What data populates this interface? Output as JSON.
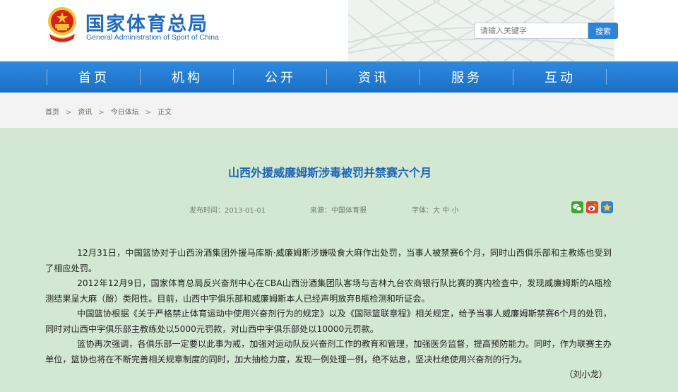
{
  "header": {
    "site_name": "国家体育总局",
    "site_name_en": "General Administration of Sport of China",
    "search_placeholder": "请输入关键字",
    "search_button": "搜索"
  },
  "nav": {
    "items": [
      "首页",
      "机构",
      "公开",
      "资讯",
      "服务",
      "互动"
    ]
  },
  "breadcrumb": {
    "items": [
      "首页",
      "资讯",
      "今日体坛",
      "正文"
    ],
    "separator": ">"
  },
  "article": {
    "title": "山西外援威廉姆斯涉毒被罚并禁赛六个月",
    "published": "发布时间：2013-01-01",
    "source": "来源：中国体育报",
    "font_label": "字体：",
    "font_large": "大",
    "font_medium": "中",
    "font_small": "小",
    "paragraphs": [
      "12月31日，中国篮协对于山西汾酒集团外援马库斯·威廉姆斯涉嫌吸食大麻作出处罚，当事人被禁赛6个月，同时山西俱乐部和主教练也受到了相应处罚。",
      "2012年12月9日，国家体育总局反兴奋剂中心在CBA山西汾酒集团队客场与吉林九台农商银行队比赛的赛内检查中，发现威廉姆斯的A瓶检测结果呈大麻（酚）类阳性。目前，山西中宇俱乐部和威廉姆斯本人已经声明放弃B瓶检测和听证会。",
      "中国篮协根据《关于严格禁止体育运动中使用兴奋剂行为的规定》以及《国际篮联章程》相关规定，给予当事人威廉姆斯禁赛6个月的处罚，同时对山西中宇俱乐部主教练处以5000元罚款，对山西中宇俱乐部处以10000元罚款。",
      "篮协再次强调，各俱乐部一定要以此事为戒，加强对运动队反兴奋剂工作的教育和管理，加强医务监督，提高预防能力。同时，作为联赛主办单位，篮协也将在不断完善相关规章制度的同时，加大抽检力度，发现一例处理一例，绝不姑息，坚决杜绝使用兴奋剂的行为。"
    ],
    "author": "（刘小龙）"
  },
  "share": {
    "icons": [
      "wechat-icon",
      "weibo-icon",
      "favorite-icon"
    ]
  },
  "colors": {
    "brand_blue": "#1f6bbf",
    "nav_blue": "#2d8ae0",
    "title_blue": "#1a64b4",
    "page_bg": "#d2e8d2"
  }
}
